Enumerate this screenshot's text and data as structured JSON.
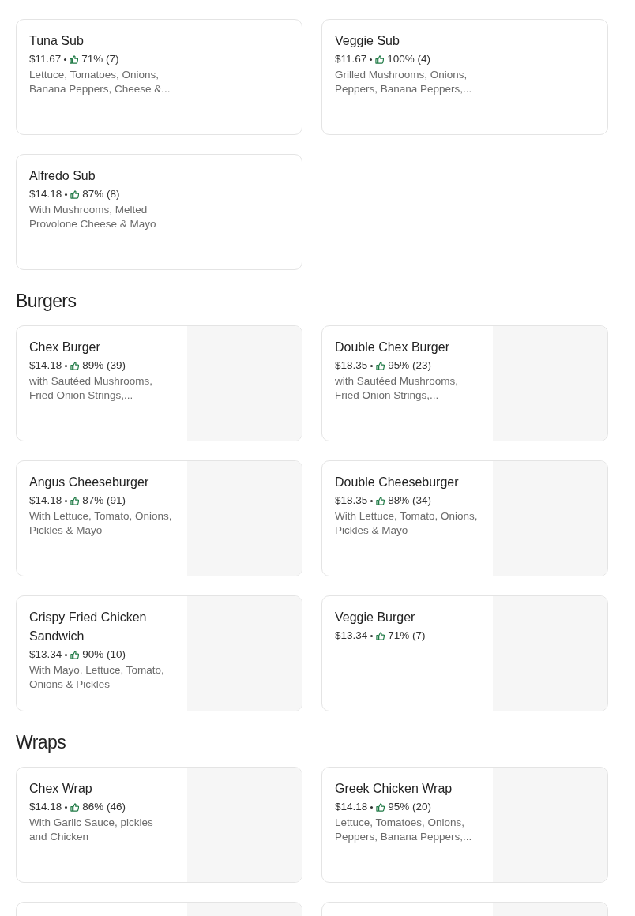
{
  "sections": [
    {
      "cards": [
        {
          "kind": "text",
          "name": "Tuna Sub",
          "price": "$11.67",
          "rating": "71% (7)",
          "description": "Lettuce, Tomatoes, Onions, Banana Peppers, Cheese &..."
        },
        {
          "kind": "text",
          "name": "Veggie Sub",
          "price": "$11.67",
          "rating": "100% (4)",
          "description": "Grilled Mushrooms, Onions, Peppers, Banana Peppers,..."
        },
        {
          "kind": "text",
          "name": "Alfredo Sub",
          "price": "$14.18",
          "rating": "87% (8)",
          "description": "With Mushrooms, Melted Provolone Cheese & Mayo"
        }
      ]
    },
    {
      "title": "Burgers",
      "cards": [
        {
          "kind": "photo",
          "name": "Chex Burger",
          "price": "$14.18",
          "rating": "89% (39)",
          "description": "with Sautéed Mushrooms, Fried Onion Strings,..."
        },
        {
          "kind": "photo",
          "name": "Double Chex Burger",
          "price": "$18.35",
          "rating": "95% (23)",
          "description": "with Sautéed Mushrooms, Fried Onion Strings,..."
        },
        {
          "kind": "photo",
          "name": "Angus Cheeseburger",
          "price": "$14.18",
          "rating": "87% (91)",
          "description": "With Lettuce, Tomato, Onions, Pickles & Mayo"
        },
        {
          "kind": "photo",
          "name": "Double Cheeseburger",
          "price": "$18.35",
          "rating": "88% (34)",
          "description": "With Lettuce, Tomato, Onions, Pickles & Mayo"
        },
        {
          "kind": "photo",
          "name": "Crispy Fried Chicken Sandwich",
          "price": "$13.34",
          "rating": "90% (10)",
          "description": "With Mayo, Lettuce, Tomato, Onions & Pickles"
        },
        {
          "kind": "photo",
          "name": "Veggie Burger",
          "price": "$13.34",
          "rating": "71% (7)"
        }
      ]
    },
    {
      "title": "Wraps",
      "cards": [
        {
          "kind": "photo",
          "name": "Chex Wrap",
          "price": "$14.18",
          "rating": "86% (46)",
          "description": "With Garlic Sauce, pickles and Chicken"
        },
        {
          "kind": "photo",
          "name": "Greek Chicken Wrap",
          "price": "$14.18",
          "rating": "95% (20)",
          "description": "Lettuce, Tomatoes, Onions, Peppers, Banana Peppers,..."
        },
        {
          "kind": "photo"
        },
        {
          "kind": "photo"
        }
      ]
    }
  ]
}
